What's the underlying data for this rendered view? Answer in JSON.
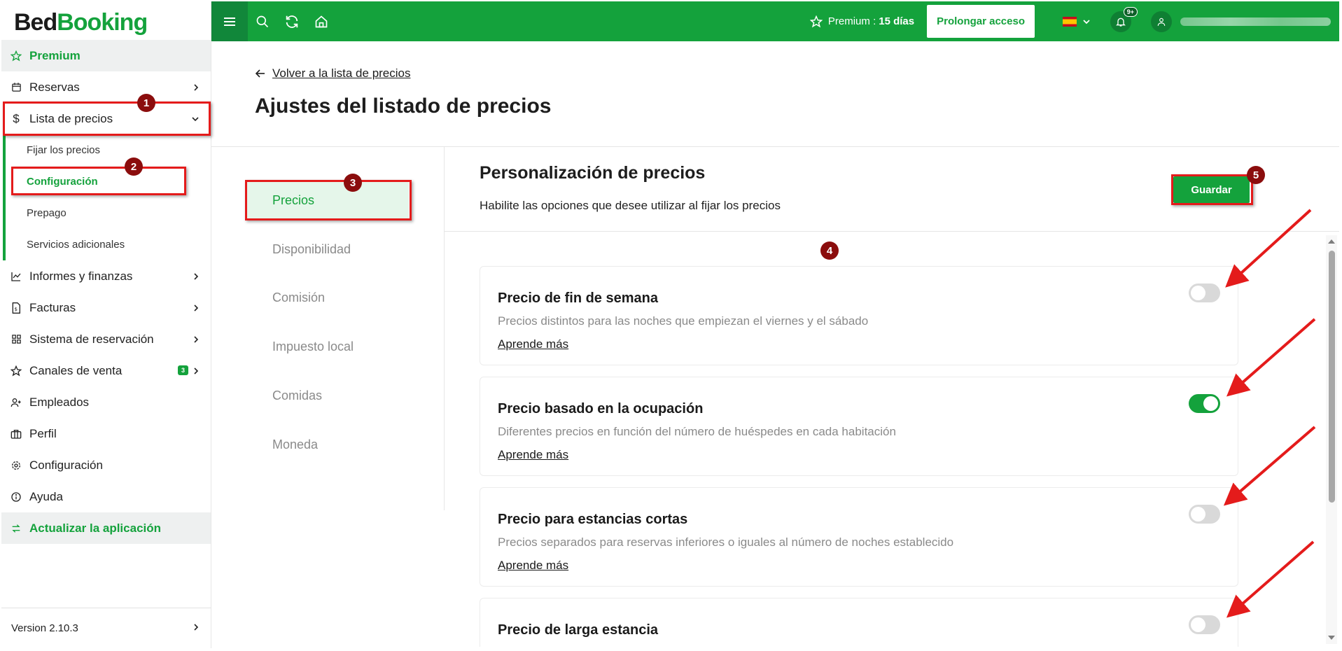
{
  "app": {
    "logo_part1": "Bed",
    "logo_part2": "Booking",
    "brand_color": "#14a23c",
    "annotation_color": "#e41b1b"
  },
  "sidebar": {
    "premium": "Premium",
    "items": [
      {
        "label": "Reservas",
        "icon": "calendar-icon"
      },
      {
        "label": "Lista de precios",
        "icon": "dollar-icon"
      },
      {
        "label": "Informes y finanzas",
        "icon": "chart-icon"
      },
      {
        "label": "Facturas",
        "icon": "invoice-icon"
      },
      {
        "label": "Sistema de reservación",
        "icon": "grid-icon"
      },
      {
        "label": "Canales de venta",
        "icon": "star-icon",
        "badge": "3"
      },
      {
        "label": "Empleados",
        "icon": "user-plus-icon"
      },
      {
        "label": "Perfil",
        "icon": "briefcase-icon"
      },
      {
        "label": "Configuración",
        "icon": "gear-icon"
      },
      {
        "label": "Ayuda",
        "icon": "info-icon"
      }
    ],
    "sub_items": [
      "Fijar los precios",
      "Configuración",
      "Prepago",
      "Servicios adicionales"
    ],
    "update": "Actualizar la aplicación",
    "version": "Version 2.10.3"
  },
  "topbar": {
    "premium_label": "Premium :",
    "premium_days": "15 días",
    "prolong": "Prolongar acceso",
    "notif_badge": "9+"
  },
  "page": {
    "back_link": "Volver a la lista de precios",
    "title": "Ajustes del listado de precios"
  },
  "settings_menu": [
    "Precios",
    "Disponibilidad",
    "Comisión",
    "Impuesto local",
    "Comidas",
    "Moneda"
  ],
  "section": {
    "title": "Personalización de precios",
    "subtitle": "Habilite las opciones que desee utilizar al fijar los precios",
    "save": "Guardar"
  },
  "cards": [
    {
      "title": "Precio de fin de semana",
      "desc": "Precios distintos para las noches que empiezan el viernes y el sábado",
      "link": "Aprende más",
      "enabled": false
    },
    {
      "title": "Precio basado en la ocupación",
      "desc": "Diferentes precios en función del número de huéspedes en cada habitación",
      "link": "Aprende más",
      "enabled": true
    },
    {
      "title": "Precio para estancias cortas",
      "desc": "Precios separados para reservas inferiores o iguales al número de noches establecido",
      "link": "Aprende más",
      "enabled": false
    },
    {
      "title": "Precio de larga estancia",
      "desc": "",
      "link": "",
      "enabled": false
    }
  ],
  "annotations": [
    "1",
    "2",
    "3",
    "4",
    "5"
  ]
}
